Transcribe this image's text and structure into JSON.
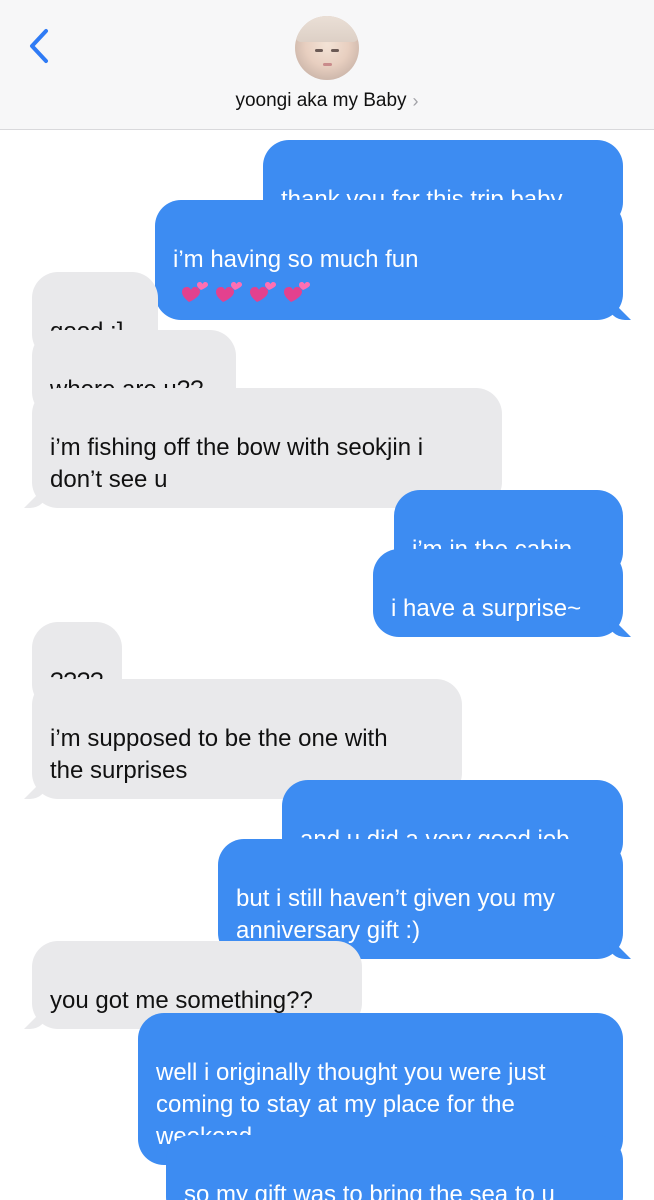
{
  "header": {
    "contact_name": "yoongi aka my Baby",
    "chevron": "›",
    "back_icon": "chevron-left-icon",
    "avatar": "contact-photo"
  },
  "colors": {
    "outgoing": "#3d8cf2",
    "incoming": "#e9e9eb",
    "accent": "#2f7bf5"
  },
  "messages": [
    {
      "from": "me",
      "text": "thank you for this trip baby"
    },
    {
      "from": "me",
      "text": "i’m having so much fun",
      "emoji": [
        "two-hearts-emoji",
        "two-hearts-emoji",
        "two-hearts-emoji",
        "two-hearts-emoji"
      ]
    },
    {
      "from": "them",
      "text": "good :]"
    },
    {
      "from": "them",
      "text": "where are u??"
    },
    {
      "from": "them",
      "text": "i’m fishing off the bow with seokjin i\ndon’t see u"
    },
    {
      "from": "me",
      "text": "i’m in the cabin"
    },
    {
      "from": "me",
      "text": "i have a surprise~"
    },
    {
      "from": "them",
      "text": "????"
    },
    {
      "from": "them",
      "text": "i’m supposed to be the one with\nthe surprises"
    },
    {
      "from": "me",
      "text": "and u did a very good job"
    },
    {
      "from": "me",
      "text": "but i still haven’t given you my\nanniversary gift :)"
    },
    {
      "from": "them",
      "text": "you got me something??"
    },
    {
      "from": "me",
      "text": "well i originally thought you were just\ncoming to stay at my place for the\nweekend"
    },
    {
      "from": "me",
      "text": "so my gift was to bring the sea to u"
    }
  ]
}
